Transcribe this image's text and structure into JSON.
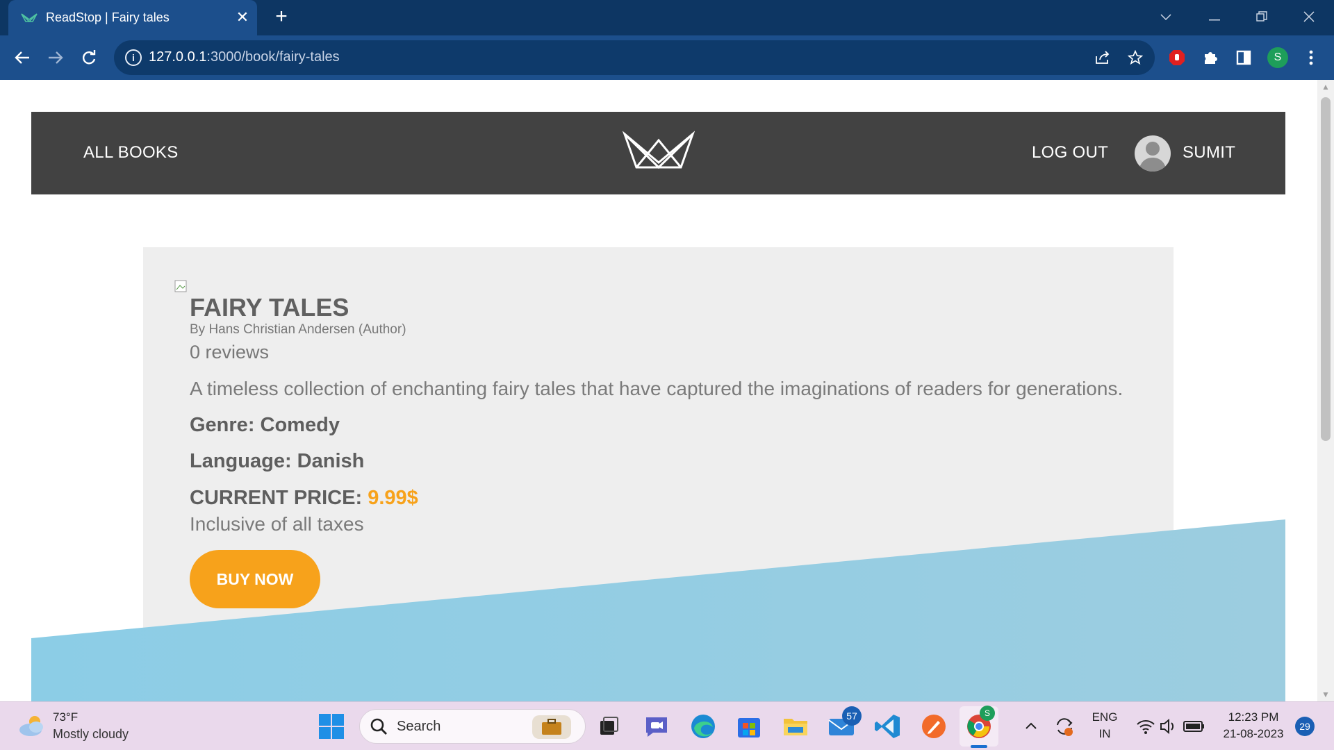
{
  "browser": {
    "tab_title": "ReadStop | Fairy tales",
    "close_glyph": "✕",
    "new_tab_glyph": "+",
    "url_host": "127.0.0.1",
    "url_path": ":3000/book/fairy-tales",
    "profile_initial": "S",
    "icons": [
      "back-arrow-icon",
      "forward-arrow-icon",
      "reload-icon",
      "site-info-icon",
      "share-icon",
      "bookmark-star-icon",
      "extension-adblock-icon",
      "extensions-puzzle-icon",
      "side-panel-icon",
      "menu-kebab-icon"
    ]
  },
  "header": {
    "all_books": "ALL BOOKS",
    "logout": "LOG OUT",
    "user_name": "SUMIT"
  },
  "book": {
    "title": "FAIRY TALES",
    "author": "By Hans Christian Andersen (Author)",
    "reviews": "0 reviews",
    "description": "A timeless collection of enchanting fairy tales that have captured the imaginations of readers for generations.",
    "genre": "Genre: Comedy",
    "language": "Language: Danish",
    "price_label": "CURRENT PRICE:",
    "price_value": "9.99$",
    "tax_note": "Inclusive of all taxes",
    "buy_label": "BUY NOW"
  },
  "colors": {
    "header_bg": "#424242",
    "card_bg": "#eeeeee",
    "accent": "#f7a21b",
    "wave": "#8ecae6"
  },
  "taskbar": {
    "weather_temp": "73°F",
    "weather_condition": "Mostly cloudy",
    "search_label": "Search",
    "mail_badge": "57",
    "chrome_badge": "S",
    "lang_top": "ENG",
    "lang_bottom": "IN",
    "time": "12:23 PM",
    "date": "21-08-2023",
    "notification_count": "29"
  }
}
